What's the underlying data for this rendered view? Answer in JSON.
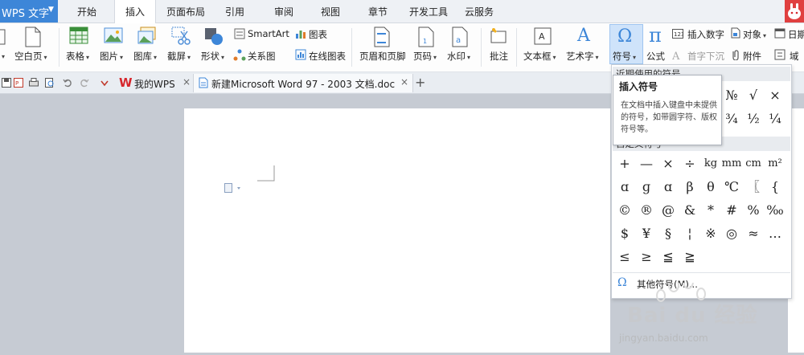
{
  "app": {
    "title": "WPS 文字"
  },
  "menu_tabs": [
    "开始",
    "插入",
    "页面布局",
    "引用",
    "审阅",
    "视图",
    "章节",
    "开发工具",
    "云服务"
  ],
  "ribbon": {
    "blank_page": "空白页",
    "table": "表格",
    "picture": "图片",
    "gallery": "图库",
    "screenshot": "截屏",
    "shape": "形状",
    "smartart": "SmartArt",
    "chart": "图表",
    "relation": "关系图",
    "online_chart": "在线图表",
    "header_footer": "页眉和页脚",
    "page_number": "页码",
    "watermark": "水印",
    "comment": "批注",
    "textbox": "文本框",
    "wordart": "艺术字",
    "symbol": "符号",
    "formula": "公式",
    "insert_number": "插入数字",
    "drop_cap": "首字下沉",
    "object": "对象",
    "attachment": "附件",
    "date": "日期",
    "field": "域"
  },
  "doc_tabs": [
    {
      "label": "我的WPS",
      "icon": "wps-logo-icon"
    },
    {
      "label": "新建Microsoft Word 97 - 2003 文档.doc",
      "icon": "doc-icon"
    }
  ],
  "symbol_panel": {
    "recent_title": "近期使用的符号",
    "recent_row1": [
      "№",
      "√",
      "×"
    ],
    "recent_row2": [
      "¾",
      "½",
      "¼"
    ],
    "custom_title": "自定义符号",
    "grid": [
      [
        "+",
        "—",
        "×",
        "÷",
        "kg",
        "mm",
        "cm",
        "m²"
      ],
      [
        "ɑ",
        "ɡ",
        "ɑ",
        "β",
        "θ",
        "℃",
        "〖",
        "{"
      ],
      [
        "©",
        "®",
        "@",
        "&",
        "*",
        "#",
        "%",
        "‰"
      ],
      [
        "$",
        "¥",
        "§",
        "¦",
        "※",
        "◎",
        "≈",
        "…"
      ],
      [
        "≤",
        "≥",
        "≦",
        "≧"
      ]
    ],
    "more_label": "其他符号(M)..."
  },
  "tooltip": {
    "title": "插入符号",
    "body": "在文档中插入键盘中未提供的符号，如带圆字符、版权符号等。"
  },
  "watermark": {
    "brand": "Bai du 经验",
    "url": "jingyan.baidu.com"
  },
  "colors": {
    "accent": "#3d86d8",
    "selected_button": "#cfe3fa",
    "wps_red": "#d6262c"
  }
}
